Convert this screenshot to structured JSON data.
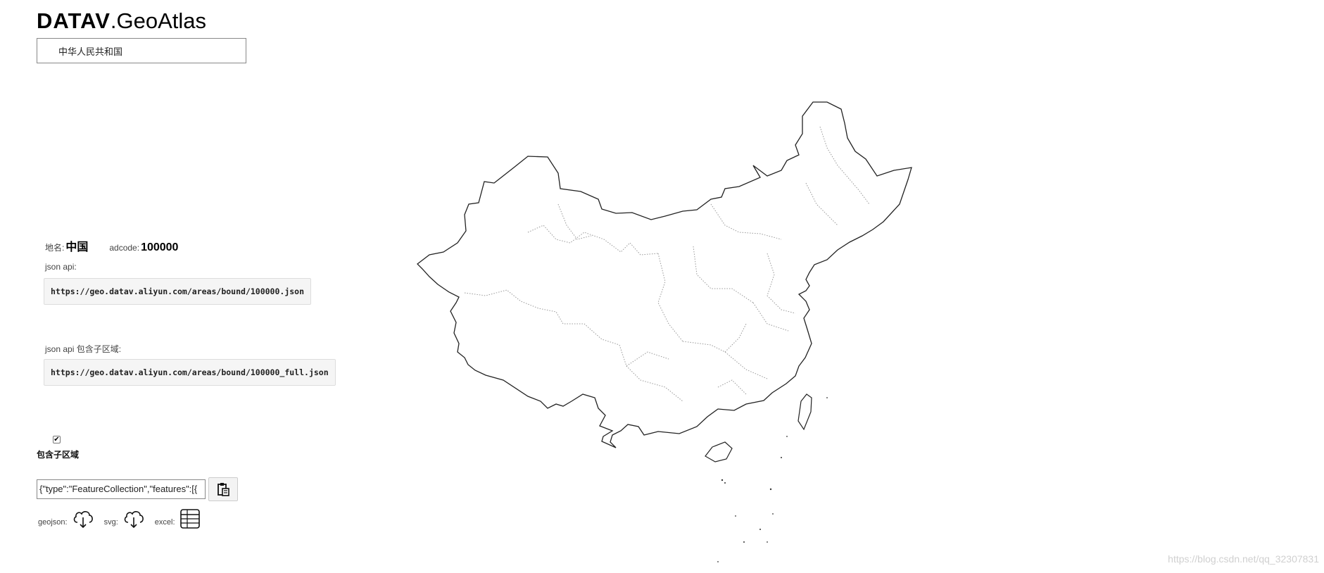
{
  "logo": {
    "brand": "DATAV",
    "product": ".GeoAtlas"
  },
  "region_select": {
    "value": "中华人民共和国"
  },
  "info": {
    "name_label": "地名:",
    "name_value": "中国",
    "adcode_label": "adcode:",
    "adcode_value": "100000"
  },
  "api": {
    "bound_label": "json api:",
    "bound_url": "https://geo.datav.aliyun.com/areas/bound/100000.json",
    "full_label": "json api 包含子区域:",
    "full_url": "https://geo.datav.aliyun.com/areas/bound/100000_full.json"
  },
  "include_children": {
    "checked": true,
    "label": "包含子区域"
  },
  "json_output": {
    "value": "{\"type\":\"FeatureCollection\",\"features\":[{"
  },
  "downloads": {
    "geojson_label": "geojson:",
    "svg_label": "svg:",
    "excel_label": "excel:"
  },
  "icons": {
    "copy": "clipboard-icon",
    "geojson": "cloud-download-icon",
    "svg": "cloud-download-icon",
    "excel": "table-icon"
  },
  "watermark": {
    "text": "https://blog.csdn.net/qq_32307831"
  }
}
